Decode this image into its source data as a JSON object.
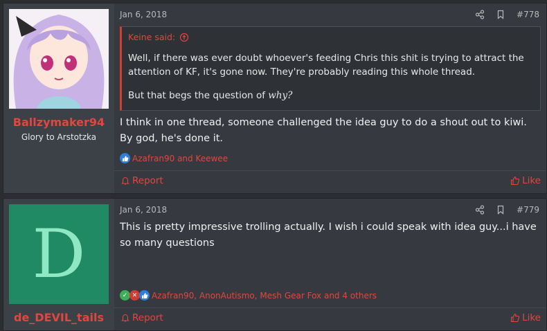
{
  "posts": [
    {
      "username": "Ballzymaker94",
      "user_title": "Glory to Arstotzka",
      "date": "Jan 6, 2018",
      "post_number": "#778",
      "quote": {
        "author": "Keine said:",
        "text": "Well, if there was ever doubt whoever's feeding Chris this shit is trying to attract the attention of KF, it's gone now. They're probably reading this whole thread.",
        "last_prefix": "But that begs the question of ",
        "last_emph": "why?"
      },
      "body": "I think in one thread, someone challenged the idea guy to do a shout out to kiwi. By god, he's done it.",
      "reactions": "Azafran90 and Keewee",
      "report_label": "Report",
      "like_label": "Like"
    },
    {
      "username": "de_DEVIL_tails",
      "avatar_letter": "D",
      "date": "Jan 6, 2018",
      "post_number": "#779",
      "body": "This is pretty impressive trolling actually. I wish i could speak with idea guy...i have so many questions",
      "reactions": "Azafran90, AnonAutismo, Mesh Gear Fox and 4 others",
      "report_label": "Report",
      "like_label": "Like"
    }
  ],
  "colors": {
    "accent": "#e0473e",
    "background": "#2b2d31",
    "post_bg": "#363a40",
    "avatar_green": "#1f8a63"
  },
  "icons": [
    "share-icon",
    "bookmark-icon",
    "arrow-up-circle-icon",
    "bell-icon",
    "thumbs-up-icon",
    "like-reaction-icon",
    "check-reaction-icon",
    "x-reaction-icon"
  ]
}
